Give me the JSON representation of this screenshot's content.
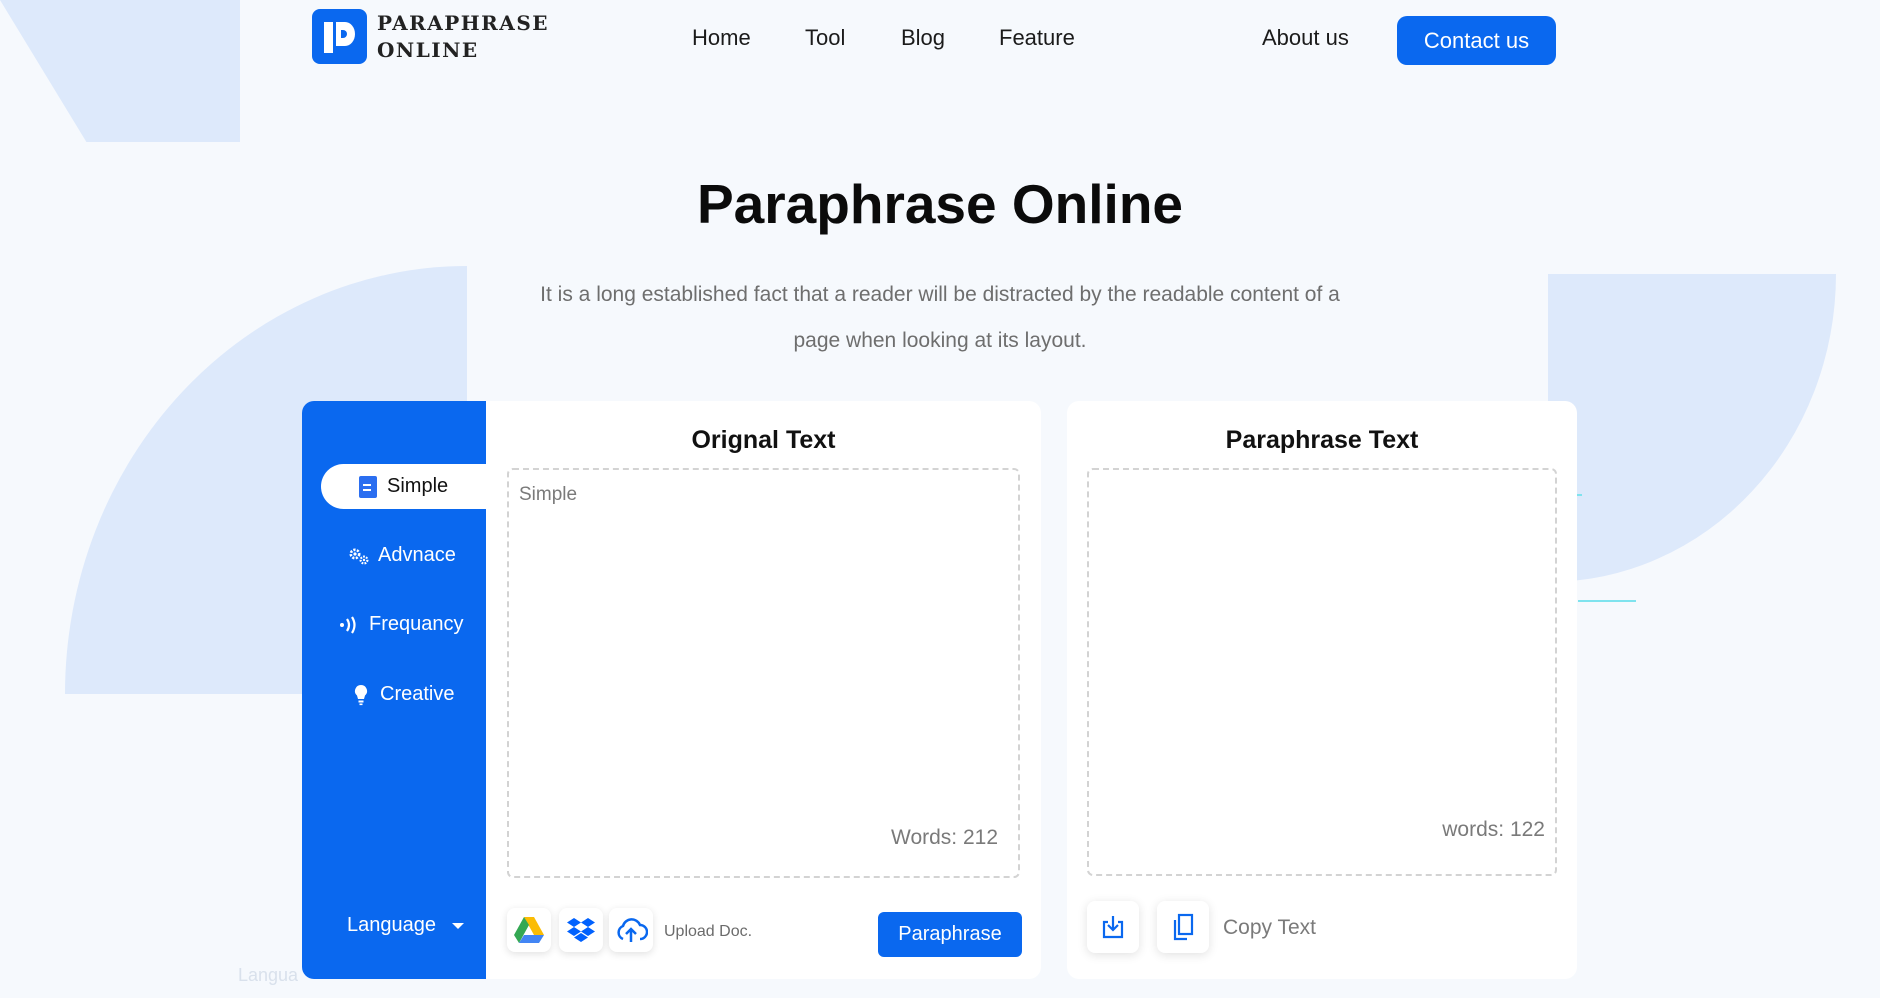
{
  "brand": {
    "line1": "PARAPHRASE",
    "line2": "ONLINE",
    "accent": "#0a68ef"
  },
  "nav": {
    "home": "Home",
    "tool": "Tool",
    "blog": "Blog",
    "feature": "Feature",
    "about": "About us",
    "contact": "Contact us"
  },
  "hero": {
    "title": "Paraphrase Online",
    "subtitle": "It is a long established fact that a reader will be distracted by the readable content of a page when looking at its layout."
  },
  "modes": [
    {
      "label": "Simple",
      "icon": "document-icon",
      "active": true
    },
    {
      "label": "Advnace",
      "icon": "gears-icon",
      "active": false
    },
    {
      "label": "Frequancy",
      "icon": "signal-icon",
      "active": false
    },
    {
      "label": "Creative",
      "icon": "bulb-icon",
      "active": false
    }
  ],
  "language": {
    "label": "Language",
    "ghost": "Langua"
  },
  "original": {
    "title": "Orignal Text",
    "placeholder": "Simple",
    "word_count": "Words: 212",
    "upload_label": "Upload Doc.",
    "button": "Paraphrase"
  },
  "paraphrased": {
    "title": "Paraphrase Text",
    "word_count": "words: 122",
    "copy_label": "Copy Text"
  }
}
